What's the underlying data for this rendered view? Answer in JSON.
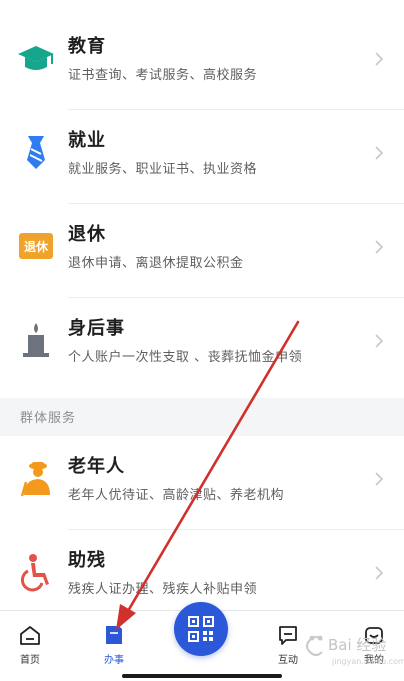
{
  "services": [
    {
      "title": "教育",
      "subtitle": "证书查询、考试服务、高校服务",
      "icon": "graduation-cap-icon"
    },
    {
      "title": "就业",
      "subtitle": "就业服务、职业证书、执业资格",
      "icon": "necktie-icon"
    },
    {
      "title": "退休",
      "subtitle": "退休申请、离退休提取公积金",
      "icon": "retire-badge-icon",
      "badge_text": "退休"
    },
    {
      "title": "身后事",
      "subtitle": "个人账户一次性支取 、丧葬抚恤金申领",
      "icon": "candle-icon"
    }
  ],
  "group_section": {
    "header": "群体服务",
    "items": [
      {
        "title": "老年人",
        "subtitle": "老年人优待证、高龄津贴、养老机构",
        "icon": "elderly-person-icon"
      },
      {
        "title": "助残",
        "subtitle": "残疾人证办理、残疾人补贴申领",
        "icon": "wheelchair-icon"
      }
    ]
  },
  "tabbar": {
    "tabs": [
      {
        "label": "首页",
        "icon": "home-icon",
        "active": false
      },
      {
        "label": "办事",
        "icon": "service-folder-icon",
        "active": true
      },
      {
        "label": "互动",
        "icon": "message-icon",
        "active": false
      },
      {
        "label": "我的",
        "icon": "profile-icon",
        "active": false
      }
    ],
    "scan_icon": "qr-scan-icon"
  },
  "colors": {
    "accent": "#2b58d8",
    "education": "#16a68d",
    "employment": "#2e7cf0",
    "retire": "#f0a32b",
    "funeral": "#6d737c",
    "elderly": "#f39a1d",
    "disability": "#e45347",
    "annotation_arrow": "#d0312d"
  },
  "watermark": {
    "text": "Bai 经验",
    "subtext": "jingyan.baidu.com"
  }
}
